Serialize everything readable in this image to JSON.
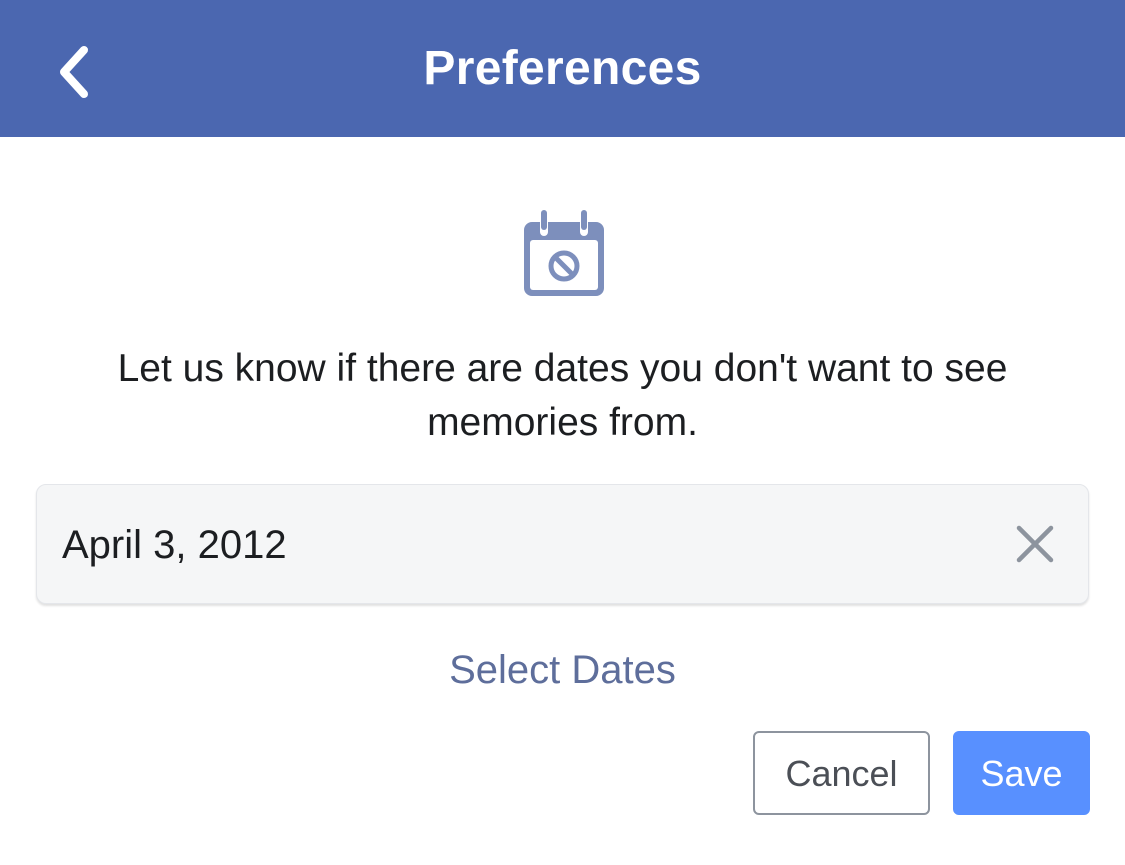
{
  "header": {
    "title": "Preferences",
    "back_icon": "chevron-left-icon",
    "background_color": "#4b67b0"
  },
  "illustration": {
    "icon": "calendar-blocked-icon",
    "color": "#7d8fbc"
  },
  "message": "Let us know if there are dates you don't want to see memories from.",
  "date_entry": {
    "value": "April 3, 2012",
    "clear_icon": "close-icon"
  },
  "select_dates_label": "Select Dates",
  "actions": {
    "cancel_label": "Cancel",
    "save_label": "Save",
    "save_color": "#5890ff"
  }
}
